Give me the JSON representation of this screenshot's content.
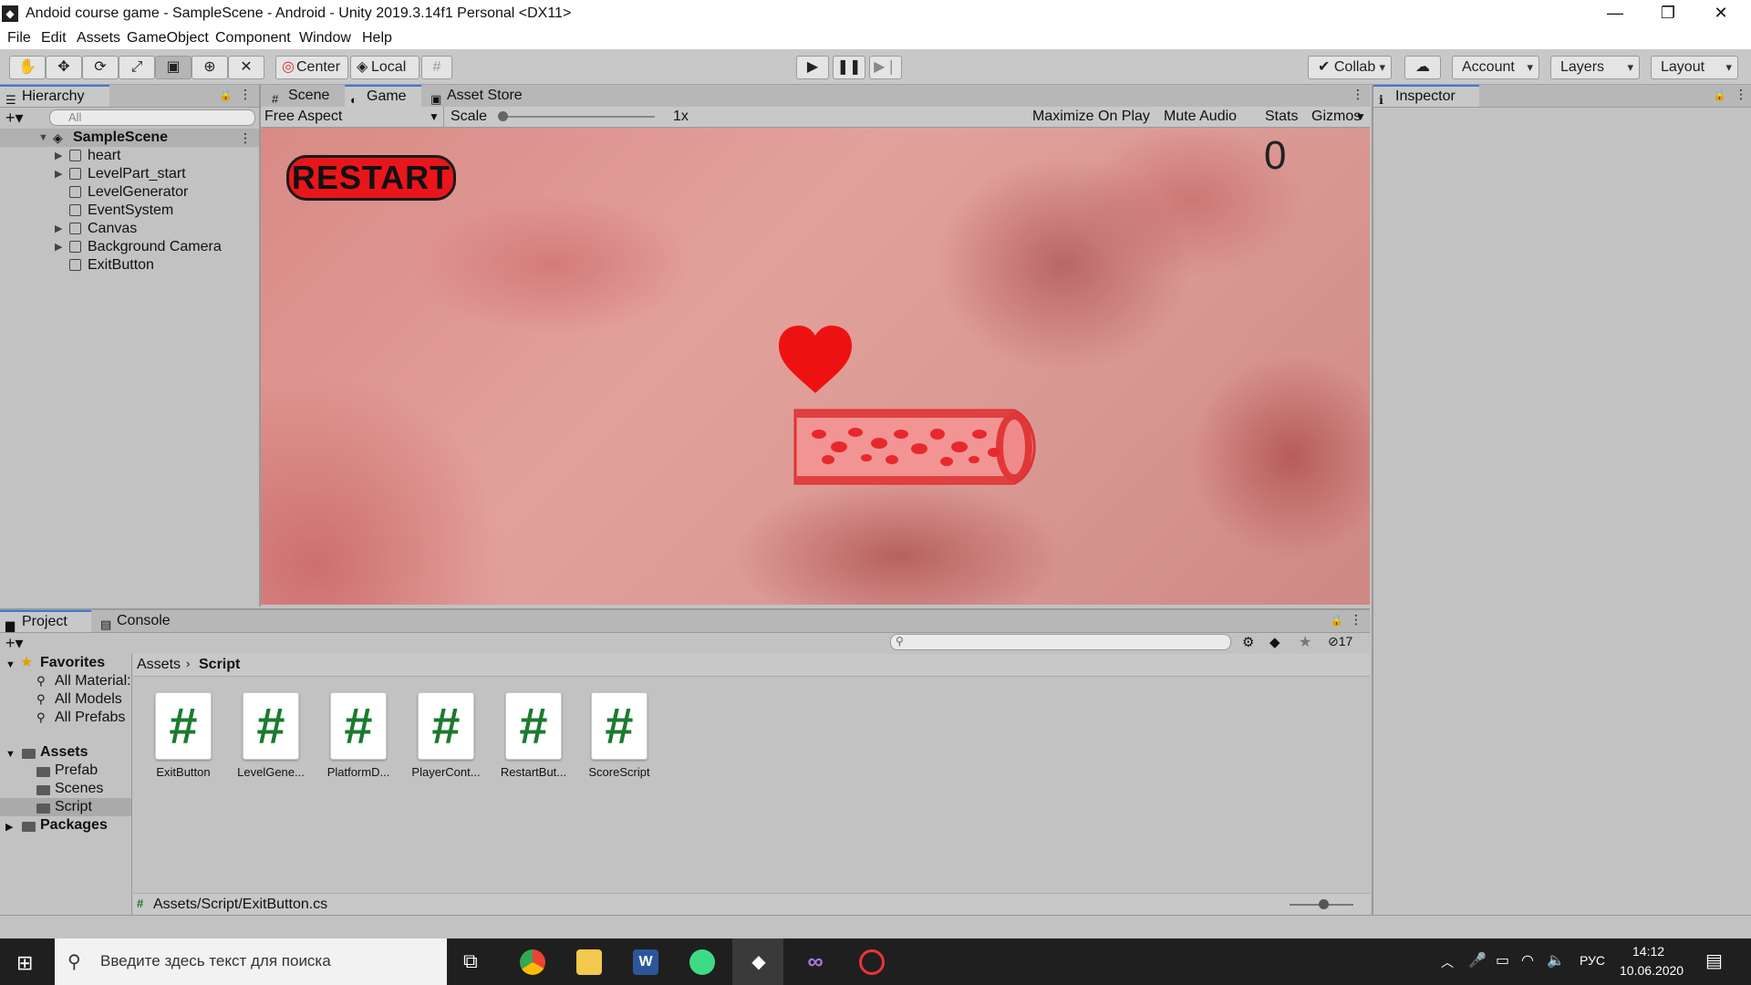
{
  "window": {
    "title": "Andoid course game - SampleScene - Android - Unity 2019.3.14f1 Personal <DX11>",
    "min_glyph": "—",
    "restore_glyph": "❐",
    "close_glyph": "✕"
  },
  "menu": [
    "File",
    "Edit",
    "Assets",
    "GameObject",
    "Component",
    "Window",
    "Help"
  ],
  "toolbar": {
    "center_label": "Center",
    "local_label": "Local",
    "collab_label": "Collab",
    "account_label": "Account",
    "layers_label": "Layers",
    "layout_label": "Layout"
  },
  "hierarchy": {
    "tab_label": "Hierarchy",
    "search_placeholder": "All",
    "scene": "SampleScene",
    "items": [
      "heart",
      "LevelPart_start",
      "LevelGenerator",
      "EventSystem",
      "Canvas",
      "Background Camera",
      "ExitButton"
    ]
  },
  "center_tabs": {
    "scene": "Scene",
    "game": "Game",
    "asset_store": "Asset Store"
  },
  "gamebar": {
    "aspect": "Free Aspect",
    "scale_label": "Scale",
    "scale_value": "1x",
    "maximize": "Maximize On Play",
    "mute": "Mute Audio",
    "stats": "Stats",
    "gizmos": "Gizmos"
  },
  "game": {
    "restart_text": "RESTART",
    "score": "0"
  },
  "inspector": {
    "tab_label": "Inspector"
  },
  "project": {
    "tab_project": "Project",
    "tab_console": "Console",
    "hidden_count": "17",
    "favorites_label": "Favorites",
    "favorites": [
      "All Material:",
      "All Models",
      "All Prefabs"
    ],
    "assets_label": "Assets",
    "asset_folders": [
      "Prefab",
      "Scenes",
      "Script"
    ],
    "packages_label": "Packages",
    "breadcrumb": [
      "Assets",
      "Script"
    ],
    "files": [
      "ExitButton",
      "LevelGene...",
      "PlatformD...",
      "PlayerCont...",
      "RestartBut...",
      "ScoreScript"
    ],
    "selected_path": "Assets/Script/ExitButton.cs"
  },
  "taskbar": {
    "search_placeholder": "Введите здесь текст для поиска",
    "lang": "РУС",
    "time": "14:12",
    "date": "10.06.2020"
  }
}
